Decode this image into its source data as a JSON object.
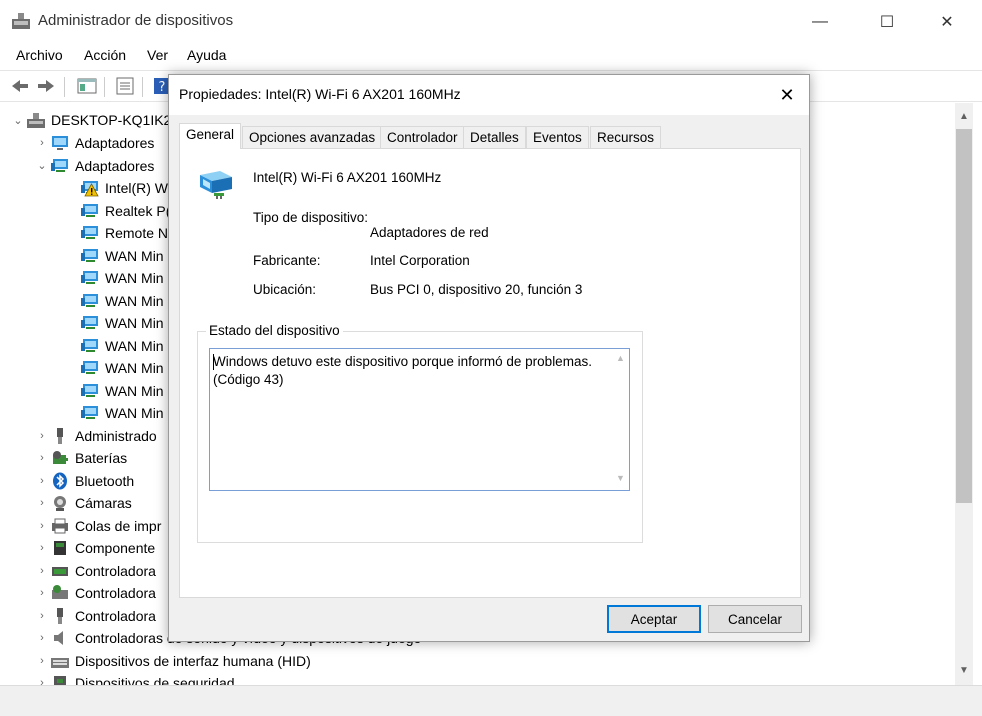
{
  "window": {
    "title": "Administrador de dispositivos",
    "minimize": "—",
    "maximize": "☐",
    "close": "✕"
  },
  "menu": [
    "Archivo",
    "Acción",
    "Ver",
    "Ayuda"
  ],
  "tree": {
    "root": "DESKTOP-KQ1IK2",
    "items": [
      {
        "label": "Adaptadores",
        "level": 1,
        "expander": "›",
        "icon": "display-adapter-icon"
      },
      {
        "label": "Adaptadores",
        "level": 1,
        "expander": "⌄",
        "icon": "network-adapter-icon"
      },
      {
        "label": "Intel(R) W",
        "level": 2,
        "expander": "",
        "icon": "warning-network-icon"
      },
      {
        "label": "Realtek P(",
        "level": 2,
        "expander": "",
        "icon": "network-adapter-icon"
      },
      {
        "label": "Remote N",
        "level": 2,
        "expander": "",
        "icon": "network-adapter-icon"
      },
      {
        "label": "WAN Min",
        "level": 2,
        "expander": "",
        "icon": "network-adapter-icon"
      },
      {
        "label": "WAN Min",
        "level": 2,
        "expander": "",
        "icon": "network-adapter-icon"
      },
      {
        "label": "WAN Min",
        "level": 2,
        "expander": "",
        "icon": "network-adapter-icon"
      },
      {
        "label": "WAN Min",
        "level": 2,
        "expander": "",
        "icon": "network-adapter-icon"
      },
      {
        "label": "WAN Min",
        "level": 2,
        "expander": "",
        "icon": "network-adapter-icon"
      },
      {
        "label": "WAN Min",
        "level": 2,
        "expander": "",
        "icon": "network-adapter-icon"
      },
      {
        "label": "WAN Min",
        "level": 2,
        "expander": "",
        "icon": "network-adapter-icon"
      },
      {
        "label": "WAN Min",
        "level": 2,
        "expander": "",
        "icon": "network-adapter-icon"
      },
      {
        "label": "Administrado",
        "level": 1,
        "expander": "›",
        "icon": "usb-icon"
      },
      {
        "label": "Baterías",
        "level": 1,
        "expander": "›",
        "icon": "battery-icon"
      },
      {
        "label": "Bluetooth",
        "level": 1,
        "expander": "›",
        "icon": "bluetooth-icon"
      },
      {
        "label": "Cámaras",
        "level": 1,
        "expander": "›",
        "icon": "camera-icon"
      },
      {
        "label": "Colas de impr",
        "level": 1,
        "expander": "›",
        "icon": "printer-icon"
      },
      {
        "label": "Componente",
        "level": 1,
        "expander": "›",
        "icon": "component-icon"
      },
      {
        "label": "Controladora",
        "level": 1,
        "expander": "›",
        "icon": "controller-icon"
      },
      {
        "label": "Controladora",
        "level": 1,
        "expander": "›",
        "icon": "storage-controller-icon"
      },
      {
        "label": "Controladora",
        "level": 1,
        "expander": "›",
        "icon": "usb-controller-icon"
      },
      {
        "label": "Controladoras de sonido y vídeo y dispositivos de juego",
        "level": 1,
        "expander": "›",
        "icon": "speaker-icon"
      },
      {
        "label": "Dispositivos de interfaz humana (HID)",
        "level": 1,
        "expander": "›",
        "icon": "hid-icon"
      },
      {
        "label": "Dispositivos de seguridad",
        "level": 1,
        "expander": "›",
        "icon": "security-device-icon"
      }
    ]
  },
  "dialog": {
    "title": "Propiedades: Intel(R) Wi-Fi 6 AX201 160MHz",
    "close": "✕",
    "tabs": [
      "General",
      "Opciones avanzadas",
      "Controlador",
      "Detalles",
      "Eventos",
      "Recursos"
    ],
    "active_tab": "General",
    "device_name": "Intel(R) Wi-Fi 6 AX201 160MHz",
    "device_type_label": "Tipo de dispositivo:",
    "device_type_value": "Adaptadores de red",
    "manufacturer_label": "Fabricante:",
    "manufacturer_value": "Intel Corporation",
    "location_label": "Ubicación:",
    "location_value": "Bus PCI 0, dispositivo 20, función 3",
    "status_group_label": "Estado del dispositivo",
    "status_text": "Windows detuvo este dispositivo porque informó de problemas. (Código 43)",
    "ok_button": "Aceptar",
    "cancel_button": "Cancelar"
  },
  "colors": {
    "accent": "#0078d7",
    "network_icon": "#2b8fd9",
    "warning": "#f2c200"
  }
}
